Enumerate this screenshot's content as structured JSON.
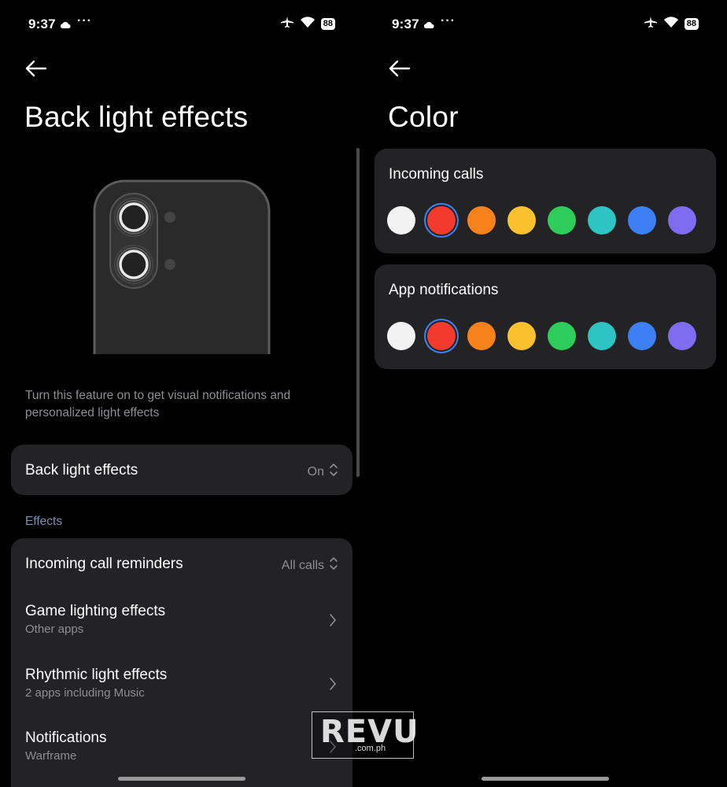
{
  "status": {
    "time": "9:37",
    "dots": "···",
    "battery": "88"
  },
  "left": {
    "title": "Back light effects",
    "description": "Turn this feature on to get visual notifications and personalized light effects",
    "toggle_row": {
      "label": "Back light effects",
      "value": "On"
    },
    "section_label": "Effects",
    "rows": [
      {
        "title": "Incoming call reminders",
        "value": "All calls"
      },
      {
        "title": "Game lighting effects",
        "subtitle": "Other apps"
      },
      {
        "title": "Rhythmic light effects",
        "subtitle": "2 apps including Music"
      },
      {
        "title": "Notifications",
        "subtitle": "Warframe"
      }
    ]
  },
  "right": {
    "title": "Color",
    "cards": [
      {
        "title": "Incoming calls",
        "selected": "red"
      },
      {
        "title": "App notifications",
        "selected": "red"
      }
    ],
    "swatches": [
      {
        "name": "white",
        "color": "#f2f2f2"
      },
      {
        "name": "red",
        "color": "#f23b2c"
      },
      {
        "name": "orange",
        "color": "#f7821b"
      },
      {
        "name": "yellow",
        "color": "#fbc02d"
      },
      {
        "name": "green",
        "color": "#2ecc5a"
      },
      {
        "name": "teal",
        "color": "#2ec4c4"
      },
      {
        "name": "blue",
        "color": "#3d7ff5"
      },
      {
        "name": "purple",
        "color": "#7f6cf0"
      }
    ]
  },
  "watermark": {
    "text": "REVU",
    "sub": ".com.ph"
  },
  "colors": {
    "card_bg": "#232325",
    "selected_ring": "#3b82f6",
    "section_label": "#7f8db0"
  }
}
